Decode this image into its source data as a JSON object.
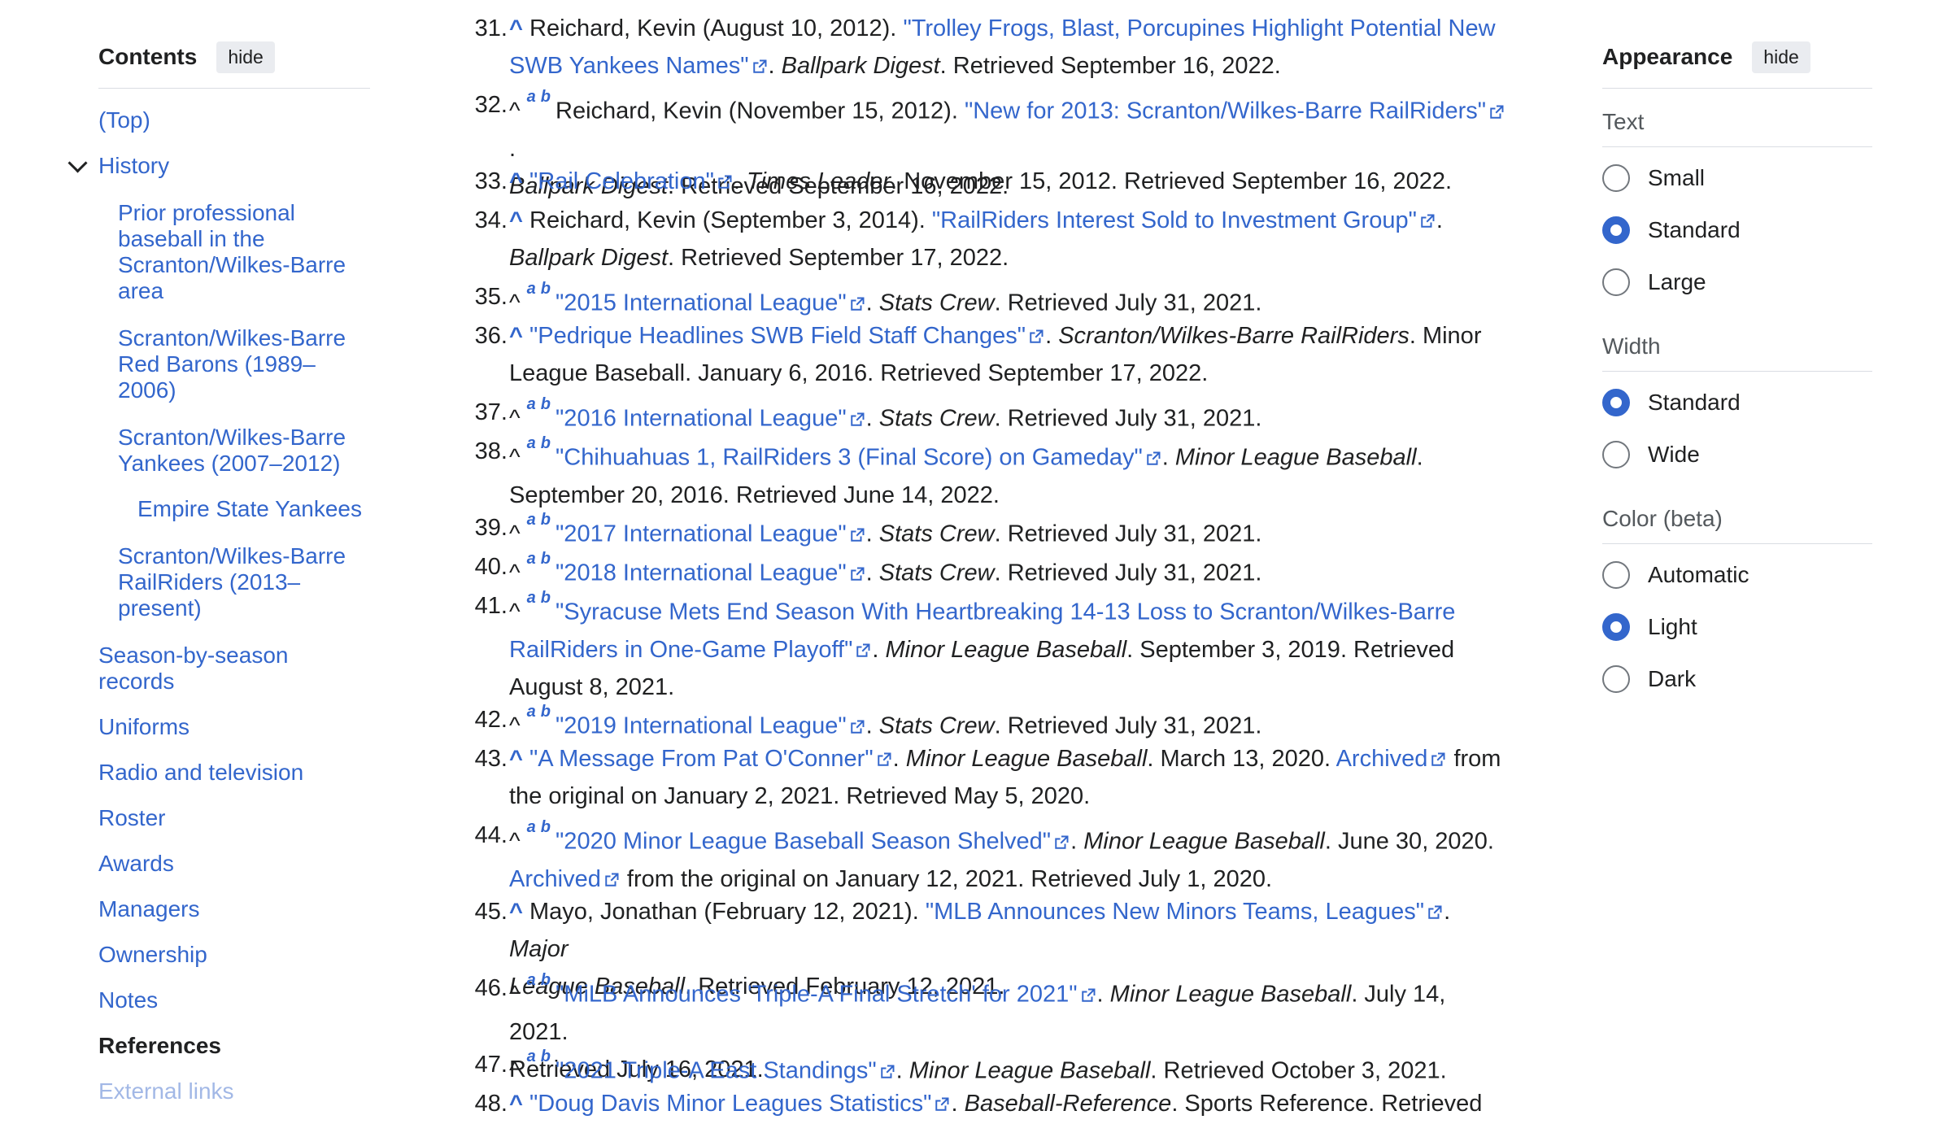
{
  "toc": {
    "title": "Contents",
    "hide_label": "hide",
    "items": [
      {
        "label": "(Top)"
      },
      {
        "label": "History"
      },
      {
        "label": "Prior professional baseball in the Scranton/Wilkes-Barre area"
      },
      {
        "label": "Scranton/Wilkes-Barre Red Barons (1989–2006)"
      },
      {
        "label": "Scranton/Wilkes-Barre Yankees (2007–2012)"
      },
      {
        "label": "Empire State Yankees"
      },
      {
        "label": "Scranton/Wilkes-Barre RailRiders (2013–present)"
      },
      {
        "label": "Season-by-season records"
      },
      {
        "label": "Uniforms"
      },
      {
        "label": "Radio and television"
      },
      {
        "label": "Roster"
      },
      {
        "label": "Awards"
      },
      {
        "label": "Managers"
      },
      {
        "label": "Ownership"
      },
      {
        "label": "Notes"
      },
      {
        "label": "References"
      },
      {
        "label": "External links"
      }
    ]
  },
  "refs": [
    {
      "num": "31.",
      "caret": "^",
      "pre": "Reichard, Kevin (August 10, 2012). ",
      "link1": "\"Trolley Frogs, Blast, Porcupines Highlight Potential New",
      "link2": "SWB Yankees Names\"",
      "after": ". ",
      "ital": "Ballpark Digest",
      "tail": ". Retrieved September 16, 2022."
    },
    {
      "num": "32.",
      "caret": "^",
      "supa": "a",
      "supb": "b",
      "pre": "Reichard, Kevin (November 15, 2012). ",
      "link1": "\"New for 2013: Scranton/Wilkes-Barre RailRiders\"",
      "after": ".",
      "ital": "Ballpark Digest",
      "tail": ". Retrieved September 16, 2022."
    },
    {
      "num": "33.",
      "caret": "^",
      "link1": "\"Rail Celebration\"",
      "after": ". ",
      "ital": "Times Leader",
      "tail": ". November 15, 2012. Retrieved September 16, 2022."
    },
    {
      "num": "34.",
      "caret": "^",
      "pre": "Reichard, Kevin (September 3, 2014). ",
      "link1": "\"RailRiders Interest Sold to Investment Group\"",
      "after": ".",
      "ital": "Ballpark Digest",
      "tail": ". Retrieved September 17, 2022."
    },
    {
      "num": "35.",
      "caret": "^",
      "supa": "a",
      "supb": "b",
      "link1": "\"2015 International League\"",
      "after": ". ",
      "ital": "Stats Crew",
      "tail": ". Retrieved July 31, 2021."
    },
    {
      "num": "36.",
      "caret": "^",
      "link1": "\"Pedrique Headlines SWB Field Staff Changes\"",
      "after": ". ",
      "ital": "Scranton/Wilkes-Barre RailRiders",
      "tail": ". Minor",
      "line2": "League Baseball. January 6, 2016. Retrieved September 17, 2022."
    },
    {
      "num": "37.",
      "caret": "^",
      "supa": "a",
      "supb": "b",
      "link1": "\"2016 International League\"",
      "after": ". ",
      "ital": "Stats Crew",
      "tail": ". Retrieved July 31, 2021."
    },
    {
      "num": "38.",
      "caret": "^",
      "supa": "a",
      "supb": "b",
      "link1": "\"Chihuahuas 1, RailRiders 3 (Final Score) on Gameday\"",
      "after": ". ",
      "ital": "Minor League Baseball",
      "tail": ".",
      "line2": "September 20, 2016. Retrieved June 14, 2022."
    },
    {
      "num": "39.",
      "caret": "^",
      "supa": "a",
      "supb": "b",
      "link1": "\"2017 International League\"",
      "after": ". ",
      "ital": "Stats Crew",
      "tail": ". Retrieved July 31, 2021."
    },
    {
      "num": "40.",
      "caret": "^",
      "supa": "a",
      "supb": "b",
      "link1": "\"2018 International League\"",
      "after": ". ",
      "ital": "Stats Crew",
      "tail": ". Retrieved July 31, 2021."
    },
    {
      "num": "41.",
      "caret": "^",
      "supa": "a",
      "supb": "b",
      "link1": "\"Syracuse Mets End Season With Heartbreaking 14-13 Loss to Scranton/Wilkes-Barre",
      "link2": "RailRiders in One-Game Playoff\"",
      "after": ". ",
      "ital": "Minor League Baseball",
      "tail": ". September 3, 2019. Retrieved",
      "line3": "August 8, 2021."
    },
    {
      "num": "42.",
      "caret": "^",
      "supa": "a",
      "supb": "b",
      "link1": "\"2019 International League\"",
      "after": ". ",
      "ital": "Stats Crew",
      "tail": ". Retrieved July 31, 2021."
    },
    {
      "num": "43.",
      "caret": "^",
      "link1": "\"A Message From Pat O'Conner\"",
      "after": ". ",
      "ital": "Minor League Baseball",
      "tail": ". March 13, 2020. ",
      "archived": "Archived",
      "tail2": " from",
      "line2": "the original on January 2, 2021. Retrieved May 5, 2020."
    },
    {
      "num": "44.",
      "caret": "^",
      "supa": "a",
      "supb": "b",
      "link1": "\"2020 Minor League Baseball Season Shelved\"",
      "after": ". ",
      "ital": "Minor League Baseball",
      "tail": ". June 30, 2020.",
      "archived": "Archived",
      "line2": " from the original on January 12, 2021. Retrieved July 1, 2020."
    },
    {
      "num": "45.",
      "caret": "^",
      "pre": "Mayo, Jonathan (February 12, 2021). ",
      "link1": "\"MLB Announces New Minors Teams, Leagues\"",
      "after": ". ",
      "ital": "Major",
      "ital2": "League Baseball",
      "tail": ". Retrieved February 12, 2021."
    },
    {
      "num": "46.",
      "caret": "^",
      "supa": "a",
      "supb": "b",
      "link1": "\"MiLB Announces 'Triple-A Final Stretch' for 2021\"",
      "after": ". ",
      "ital": "Minor League Baseball",
      "tail": ". July 14, 2021.",
      "line2": "Retrieved July 16, 2021."
    },
    {
      "num": "47.",
      "caret": "^",
      "supa": "a",
      "supb": "b",
      "link1": "\"2021 Triple-A East Standings\"",
      "after": ". ",
      "ital": "Minor League Baseball",
      "tail": ". Retrieved October 3, 2021."
    },
    {
      "num": "48.",
      "caret": "^",
      "link1": "\"Doug Davis Minor Leagues Statistics\"",
      "after": ". ",
      "ital": "Baseball-Reference",
      "tail": ". Sports Reference. Retrieved"
    }
  ],
  "appearance": {
    "title": "Appearance",
    "hide_label": "hide",
    "text_label": "Text",
    "text_options": [
      "Small",
      "Standard",
      "Large"
    ],
    "text_selected": "Standard",
    "width_label": "Width",
    "width_options": [
      "Standard",
      "Wide"
    ],
    "width_selected": "Standard",
    "color_label": "Color (beta)",
    "color_options": [
      "Automatic",
      "Light",
      "Dark"
    ],
    "color_selected": "Light"
  },
  "colors": {
    "link": "#3366cc",
    "text": "#202122",
    "radio_checked": "#3366cc"
  }
}
